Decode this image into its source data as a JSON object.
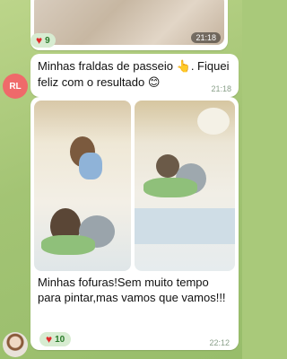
{
  "messages": [
    {
      "time": "21:18",
      "reaction": {
        "icon": "heart-icon",
        "count": "9"
      }
    },
    {
      "sender_initials": "RL",
      "text": "Minhas fraldas de passeio 👆. Fiquei feliz com o resultado 😊",
      "time": "21:18"
    },
    {
      "text": "Minhas fofuras!Sem muito tempo para pintar,mas vamos que vamos!!!",
      "time": "22:12",
      "reaction": {
        "icon": "heart-icon",
        "count": "10"
      }
    }
  ],
  "colors": {
    "reaction_bg": "#d7ecd1",
    "heart": "#e02b2b",
    "avatar_rl": "#ef6a6a",
    "chat_bg": "#a9c97a"
  }
}
